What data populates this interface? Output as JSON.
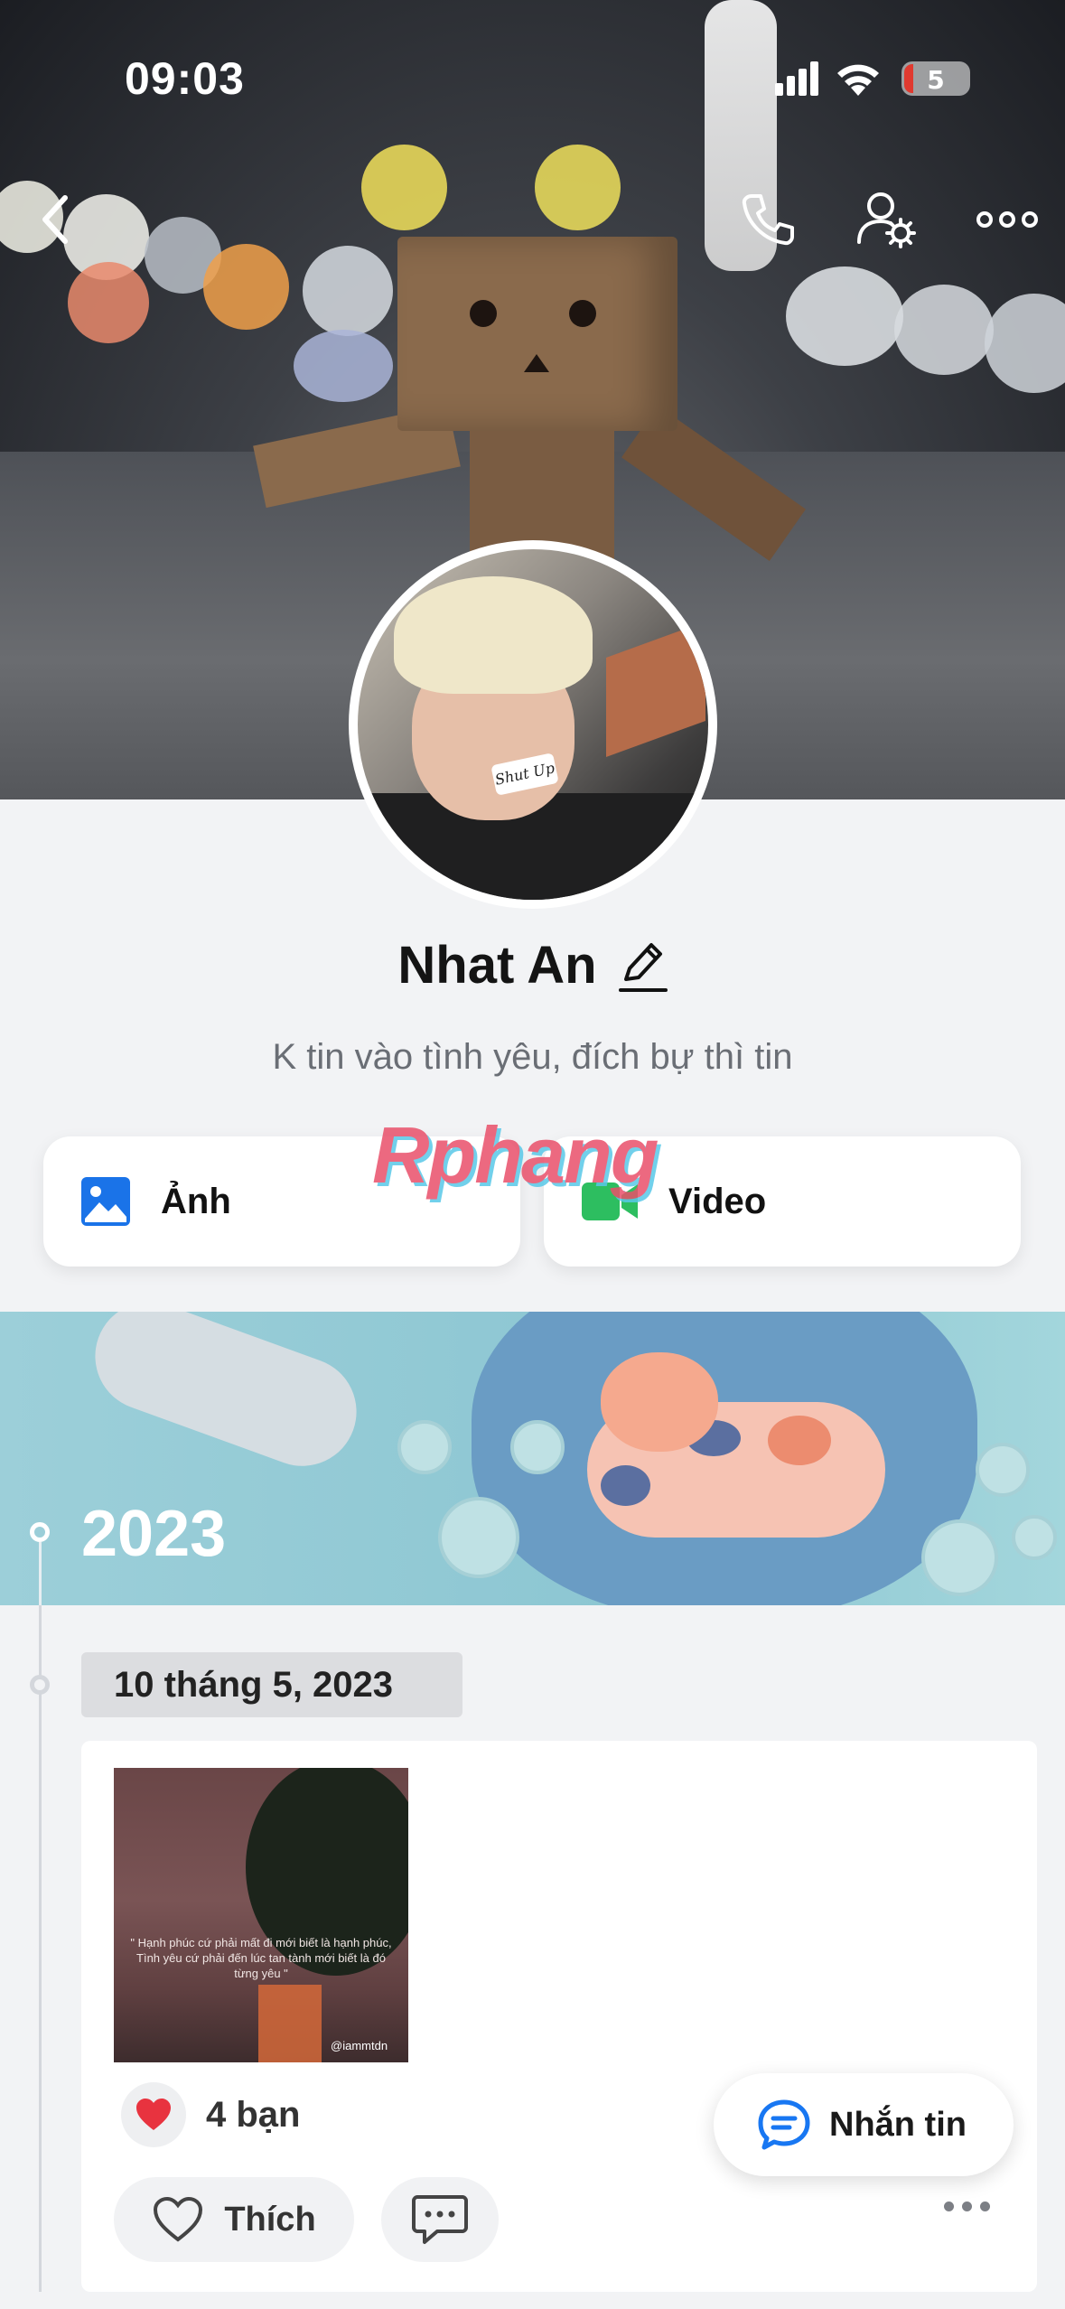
{
  "status_bar": {
    "time": "09:03",
    "battery_level": "5"
  },
  "header": {
    "icons": [
      "chevron-left-icon",
      "phone-icon",
      "user-settings-icon",
      "more-horizontal-icon"
    ]
  },
  "profile": {
    "name": "Nhat An",
    "bio": "K tin vào tình yêu, đích bự thì tin",
    "avatar_sticker": "Shut Up"
  },
  "media_buttons": {
    "photo_label": "Ảnh",
    "video_label": "Video"
  },
  "watermark": "Rphang",
  "timeline": {
    "year": "2023",
    "date": "10 tháng 5, 2023",
    "post": {
      "image_quote": "\" Hạnh phúc cứ phải mất đi mới biết là hạnh phúc, Tình yêu cứ phải đến lúc tan tành mới biết là đó từng yêu \"",
      "image_tag": "@iammtdn",
      "reactions_label": "4 bạn",
      "like_label": "Thích"
    }
  },
  "fab": {
    "message_label": "Nhắn tin"
  },
  "colors": {
    "accent_blue": "#1877f2",
    "photo_icon": "#1a73e8",
    "video_icon": "#2dbe60",
    "heart": "#e8333f"
  }
}
